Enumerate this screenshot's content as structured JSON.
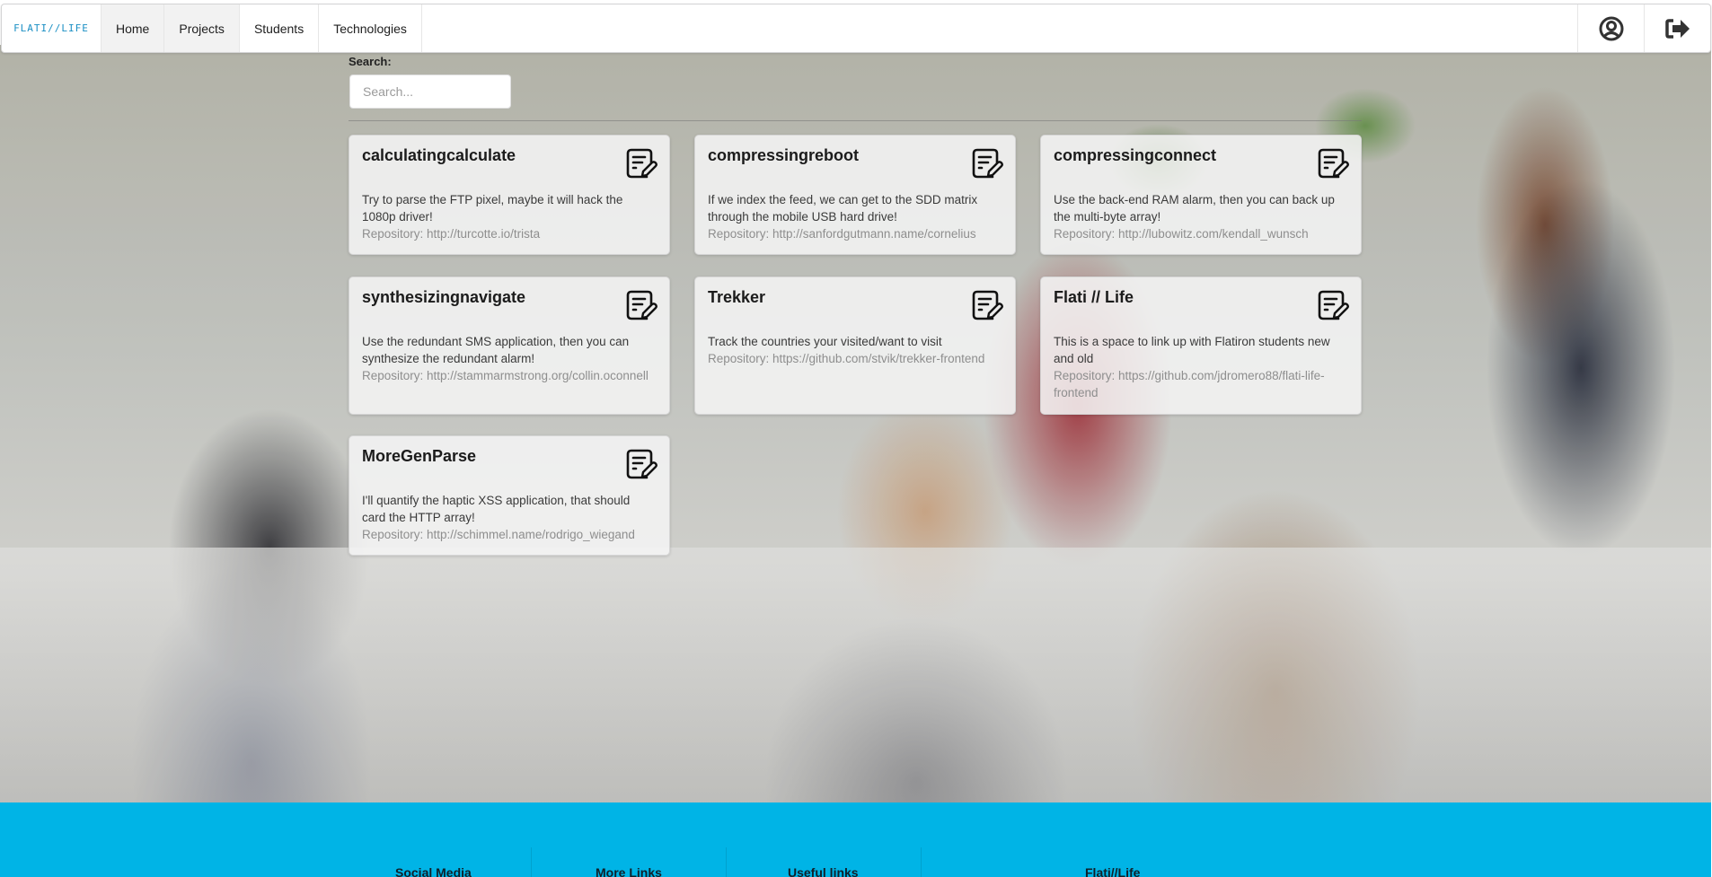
{
  "nav": {
    "logo": "FLATI//LIFE",
    "items": [
      {
        "label": "Home",
        "active": true
      },
      {
        "label": "Projects",
        "active": true
      },
      {
        "label": "Students",
        "active": false
      },
      {
        "label": "Technologies",
        "active": false
      }
    ],
    "icons": [
      "user-circle-icon",
      "sign-out-icon"
    ]
  },
  "search": {
    "label": "Search:",
    "placeholder": "Search...",
    "value": ""
  },
  "cards": [
    {
      "title": "calculatingcalculate",
      "description": "Try to parse the FTP pixel, maybe it will hack the 1080p driver!",
      "repository": "Repository: http://turcotte.io/trista"
    },
    {
      "title": "compressingreboot",
      "description": "If we index the feed, we can get to the SDD matrix through the mobile USB hard drive!",
      "repository": "Repository: http://sanfordgutmann.name/cornelius"
    },
    {
      "title": "compressingconnect",
      "description": "Use the back-end RAM alarm, then you can back up the multi-byte array!",
      "repository": "Repository: http://lubowitz.com/kendall_wunsch"
    },
    {
      "title": "synthesizingnavigate",
      "description": "Use the redundant SMS application, then you can synthesize the redundant alarm!",
      "repository": "Repository: http://stammarmstrong.org/collin.oconnell"
    },
    {
      "title": "Trekker",
      "description": "Track the countries your visited/want to visit",
      "repository": "Repository: https://github.com/stvik/trekker-frontend"
    },
    {
      "title": "Flati // Life",
      "description": "This is a space to link up with Flatiron students new and old",
      "repository": "Repository: https://github.com/jdromero88/flati-life-frontend"
    },
    {
      "title": "MoreGenParse",
      "description": "I'll quantify the haptic XSS application, that should card the HTTP array!",
      "repository": "Repository: http://schimmel.name/rodrigo_wiegand"
    }
  ],
  "footer": {
    "columns": [
      "Social Media",
      "More Links",
      "Useful links",
      "Flati//Life"
    ],
    "background": "#00b4e6"
  }
}
